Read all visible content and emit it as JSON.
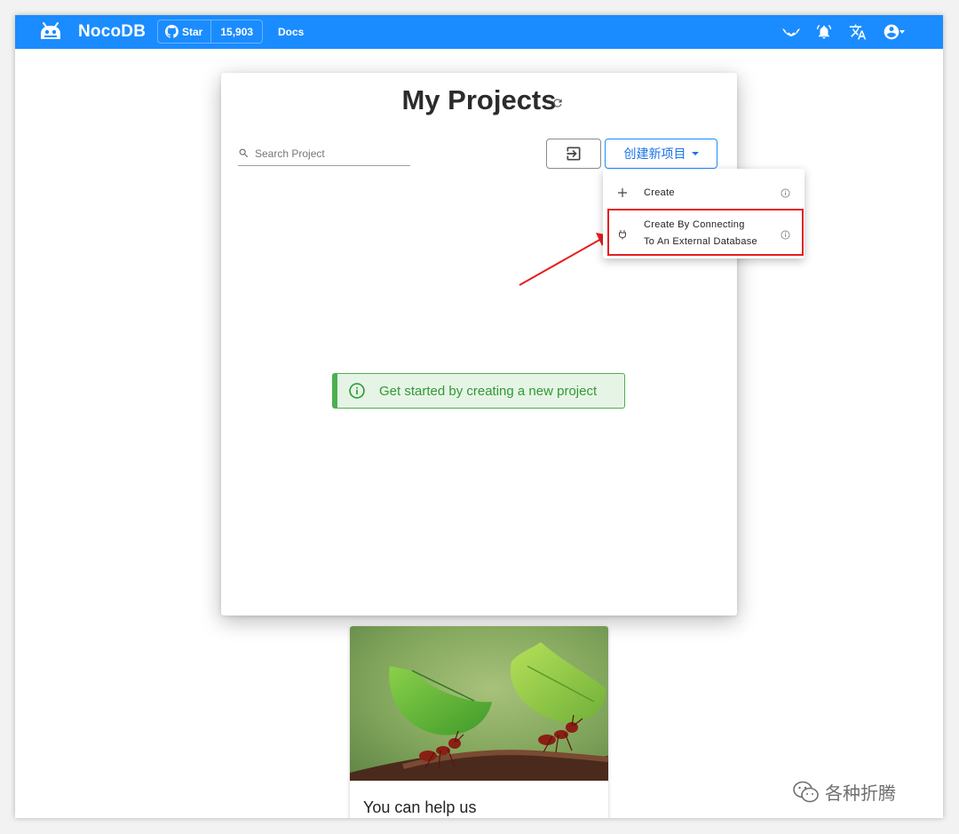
{
  "topbar": {
    "brand": "NocoDB",
    "github_star_label": "Star",
    "github_star_count": "15,903",
    "docs_label": "Docs",
    "accent_color": "#1a8cff",
    "icons": [
      "nocodb-logo-icon",
      "github-icon",
      "bat-icon",
      "bell-icon",
      "translate-icon",
      "account-circle-icon",
      "chevron-down-icon"
    ]
  },
  "main": {
    "title": "My Projects",
    "search_placeholder": "Search Project",
    "create_button_label": "创建新项目",
    "empty_alert": "Get started by creating a new project"
  },
  "dropdown": {
    "items": [
      {
        "icon": "plus-icon",
        "label_line1": "Create",
        "label_line2": ""
      },
      {
        "icon": "plug-icon",
        "label_line1": "Create By Connecting",
        "label_line2": "To An External Database"
      }
    ]
  },
  "promo": {
    "caption": "You can help us"
  },
  "watermark": {
    "text": "各种折腾"
  }
}
